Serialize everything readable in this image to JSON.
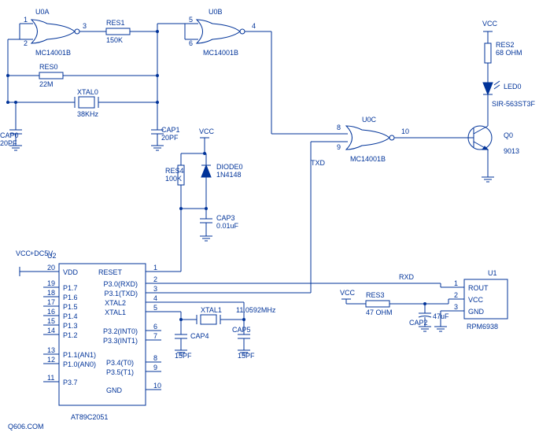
{
  "gates": {
    "U0A": {
      "name": "U0A",
      "type": "MC14001B",
      "pins": [
        "1",
        "2",
        "3"
      ]
    },
    "U0B": {
      "name": "U0B",
      "type": "MC14001B",
      "pins": [
        "5",
        "6",
        "4"
      ]
    },
    "U0C": {
      "name": "U0C",
      "type": "MC14001B",
      "pins": [
        "8",
        "9",
        "10"
      ]
    }
  },
  "resistors": {
    "RES0": {
      "name": "RES0",
      "value": "22M"
    },
    "RES1": {
      "name": "RES1",
      "value": "150K"
    },
    "RES2": {
      "name": "RES2",
      "value": "68 OHM"
    },
    "RES3": {
      "name": "RES3",
      "value": "47 OHM"
    },
    "RES4": {
      "name": "RES4",
      "value": "100K"
    }
  },
  "caps": {
    "CAP0": {
      "name": "CAP0",
      "value": "20PF"
    },
    "CAP1": {
      "name": "CAP1",
      "value": "20PF"
    },
    "CAP2": {
      "name": "CAP2",
      "value": "47uF"
    },
    "CAP3": {
      "name": "CAP3",
      "value": "0.01uF"
    },
    "CAP4": {
      "name": "CAP4",
      "value": "15PF"
    },
    "CAP5": {
      "name": "CAP5",
      "value": "15PF"
    }
  },
  "xtals": {
    "XTAL0": {
      "name": "XTAL0",
      "value": "38KHz"
    },
    "XTAL1": {
      "name": "XTAL1",
      "value": "11.0592MHz"
    }
  },
  "diode": {
    "name": "DIODE0",
    "value": "1N4148"
  },
  "led": {
    "name": "LED0",
    "value": "SIR-563ST3F"
  },
  "transistor": {
    "name": "Q0",
    "value": "9013"
  },
  "mcu": {
    "name": "U2",
    "type": "AT89C2051",
    "pwr": "+DC5V",
    "pins_left": [
      {
        "num": "20",
        "lbl": "VDD"
      },
      {
        "num": "19",
        "lbl": "P1.7"
      },
      {
        "num": "18",
        "lbl": "P1.6"
      },
      {
        "num": "17",
        "lbl": "P1.5"
      },
      {
        "num": "16",
        "lbl": "P1.4"
      },
      {
        "num": "15",
        "lbl": "P1.3"
      },
      {
        "num": "14",
        "lbl": "P1.2"
      },
      {
        "num": "13",
        "lbl": "P1.1(AN1)"
      },
      {
        "num": "12",
        "lbl": "P1.0(AN0)"
      },
      {
        "num": "11",
        "lbl": "P3.7"
      }
    ],
    "pins_right": [
      {
        "num": "1",
        "lbl": "RESET"
      },
      {
        "num": "2",
        "lbl": "P3.0(RXD)"
      },
      {
        "num": "3",
        "lbl": "P3.1(TXD)"
      },
      {
        "num": "4",
        "lbl": "XTAL2"
      },
      {
        "num": "5",
        "lbl": "XTAL1"
      },
      {
        "num": "6",
        "lbl": "P3.2(INT0)"
      },
      {
        "num": "7",
        "lbl": "P3.3(INT1)"
      },
      {
        "num": "8",
        "lbl": "P3.4(T0)"
      },
      {
        "num": "9",
        "lbl": "P3.5(T1)"
      },
      {
        "num": "10",
        "lbl": "GND"
      }
    ]
  },
  "rx_module": {
    "name": "U1",
    "type": "RPM6938",
    "pins": [
      {
        "num": "1",
        "lbl": "ROUT"
      },
      {
        "num": "2",
        "lbl": "VCC"
      },
      {
        "num": "3",
        "lbl": "GND"
      }
    ]
  },
  "nets": {
    "vcc": "VCC",
    "gnd": "GND",
    "txd": "TXD",
    "rxd": "RXD"
  },
  "watermark": "Q606.COM"
}
